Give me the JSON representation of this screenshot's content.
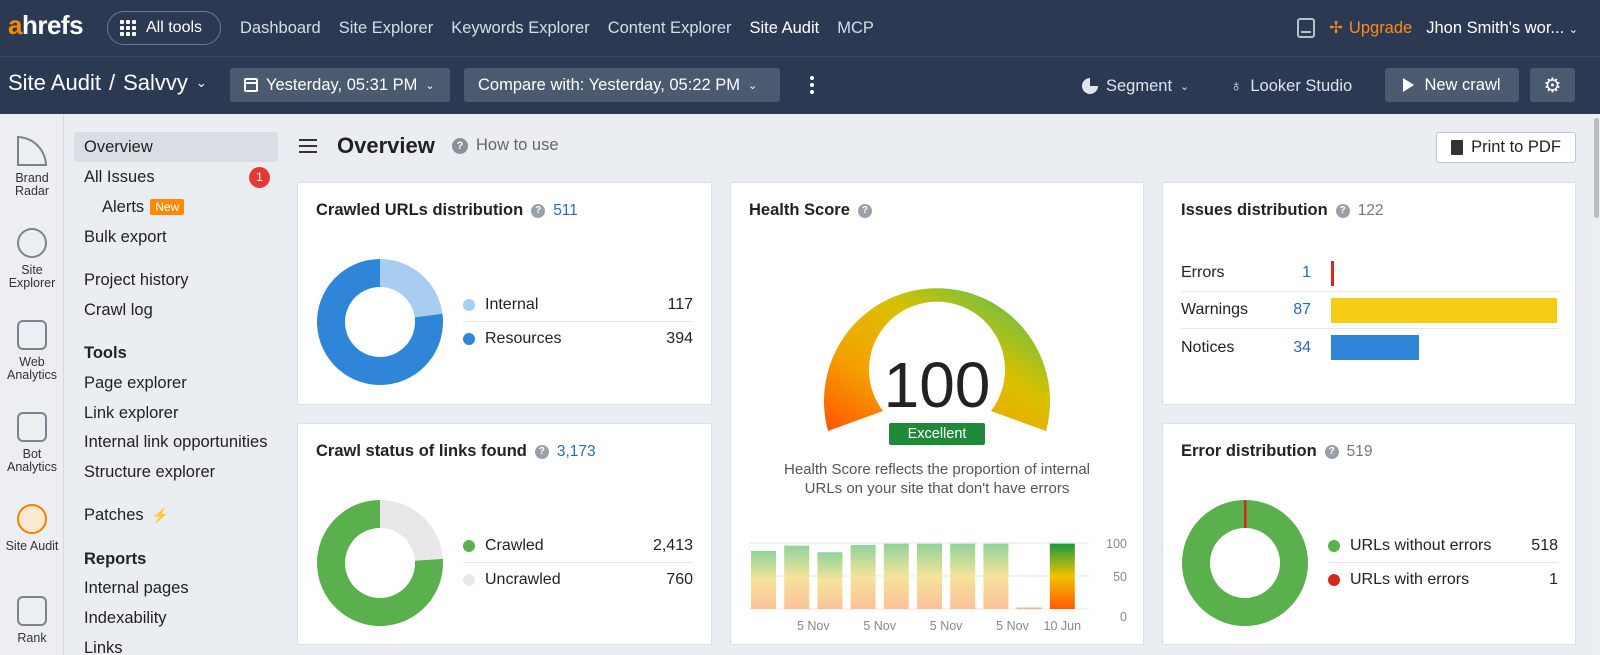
{
  "nav": {
    "logo_a": "a",
    "logo_rest": "hrefs",
    "all_tools": "All tools",
    "links": [
      "Dashboard",
      "Site Explorer",
      "Keywords Explorer",
      "Content Explorer",
      "Site Audit",
      "MCP"
    ],
    "upgrade": "Upgrade",
    "workspace": "Jhon Smith's wor..."
  },
  "subnav": {
    "crumb_root": "Site Audit",
    "crumb_sep": "/",
    "project": "Salvvy",
    "date": "Yesterday, 05:31 PM",
    "compare": "Compare with: Yesterday, 05:22 PM",
    "segment": "Segment",
    "looker": "Looker Studio",
    "new_crawl": "New crawl"
  },
  "rail": [
    "Brand Radar",
    "Site Explorer",
    "Web Analytics",
    "Bot Analytics",
    "Site Audit",
    "Rank"
  ],
  "sidebar": {
    "overview": "Overview",
    "all_issues": "All Issues",
    "all_issues_badge": "1",
    "alerts": "Alerts",
    "alerts_tag": "New",
    "bulk_export": "Bulk export",
    "project_history": "Project history",
    "crawl_log": "Crawl log",
    "tools_heading": "Tools",
    "page_explorer": "Page explorer",
    "link_explorer": "Link explorer",
    "internal_link_opps": "Internal link opportunities",
    "structure_explorer": "Structure explorer",
    "patches": "Patches",
    "reports_heading": "Reports",
    "internal_pages": "Internal pages",
    "indexability": "Indexability",
    "links": "Links"
  },
  "main": {
    "title": "Overview",
    "how_to_use": "How to use",
    "print_pdf": "Print to PDF"
  },
  "crawled": {
    "title": "Crawled URLs distribution",
    "total": "511",
    "items": [
      {
        "label": "Internal",
        "value": "117",
        "color": "#a9cdf0"
      },
      {
        "label": "Resources",
        "value": "394",
        "color": "#2f86d8"
      }
    ]
  },
  "crawl_status": {
    "title": "Crawl status of links found",
    "total": "3,173",
    "items": [
      {
        "label": "Crawled",
        "value": "2,413",
        "color": "#5bb04e"
      },
      {
        "label": "Uncrawled",
        "value": "760",
        "color": "#e8e8e8"
      }
    ]
  },
  "health": {
    "title": "Health Score",
    "score": "100",
    "rating": "Excellent",
    "desc_line1": "Health Score reflects the proportion of internal",
    "desc_line2": "URLs on your site that don't have errors",
    "y_ticks": [
      "100",
      "50",
      "0"
    ],
    "x_labels": [
      "5 Nov",
      "5 Nov",
      "5 Nov",
      "5 Nov",
      "10 Jun"
    ]
  },
  "chart_data": {
    "type": "bar",
    "categories": [
      "",
      "5 Nov",
      "",
      "5 Nov",
      "",
      "5 Nov",
      "",
      "5 Nov",
      "",
      "10 Jun"
    ],
    "values": [
      88,
      96,
      86,
      97,
      99,
      99,
      99,
      99,
      2,
      99
    ],
    "ylim": [
      0,
      100
    ],
    "y_ticks": [
      100,
      50,
      0
    ],
    "highlight_last": true
  },
  "issues": {
    "title": "Issues distribution",
    "total": "122",
    "rows": [
      {
        "label": "Errors",
        "value": "1",
        "share": 0.012,
        "color": "#d7281f"
      },
      {
        "label": "Warnings",
        "value": "87",
        "share": 1.0,
        "color": "#f6cd15"
      },
      {
        "label": "Notices",
        "value": "34",
        "share": 0.39,
        "color": "#2f86d8"
      }
    ]
  },
  "errors": {
    "title": "Error distribution",
    "total": "519",
    "items": [
      {
        "label": "URLs without errors",
        "value": "518",
        "color": "#5bb04e"
      },
      {
        "label": "URLs with errors",
        "value": "1",
        "color": "#d7281f"
      }
    ]
  }
}
